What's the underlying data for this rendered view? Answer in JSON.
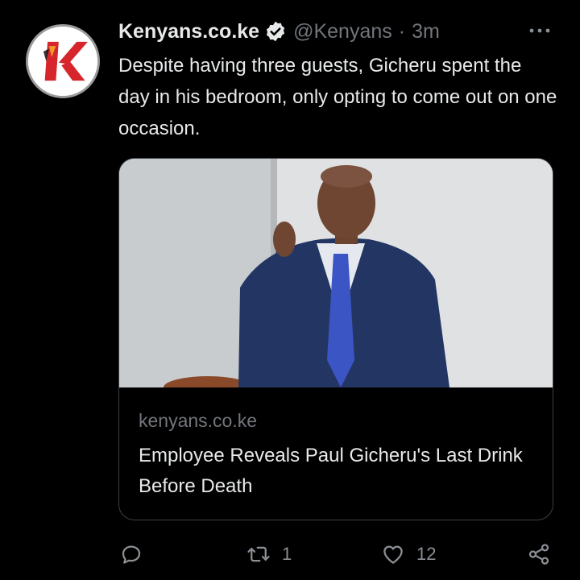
{
  "tweet": {
    "display_name": "Kenyans.co.ke",
    "handle": "@Kenyans",
    "separator": "·",
    "time": "3m",
    "text": "Despite having three guests, Gicheru spent the day in his bedroom, only opting to come out on one occasion.",
    "avatar_icon": "kenyans-logo-icon",
    "verified_icon": "verified-badge-icon",
    "more_icon": "more-dots-icon"
  },
  "card": {
    "domain": "kenyans.co.ke",
    "title": "Employee Reveals Paul Gicheru's Last Drink Before Death"
  },
  "actions": {
    "reply_icon": "reply-icon",
    "retweet_icon": "retweet-icon",
    "retweet_count": "1",
    "like_icon": "heart-icon",
    "like_count": "12",
    "share_icon": "share-icon"
  },
  "colors": {
    "background": "#000000",
    "text_primary": "#e7e9ea",
    "text_secondary": "#71767b",
    "card_border": "#3b3f43",
    "brand_red": "#d7262b"
  }
}
